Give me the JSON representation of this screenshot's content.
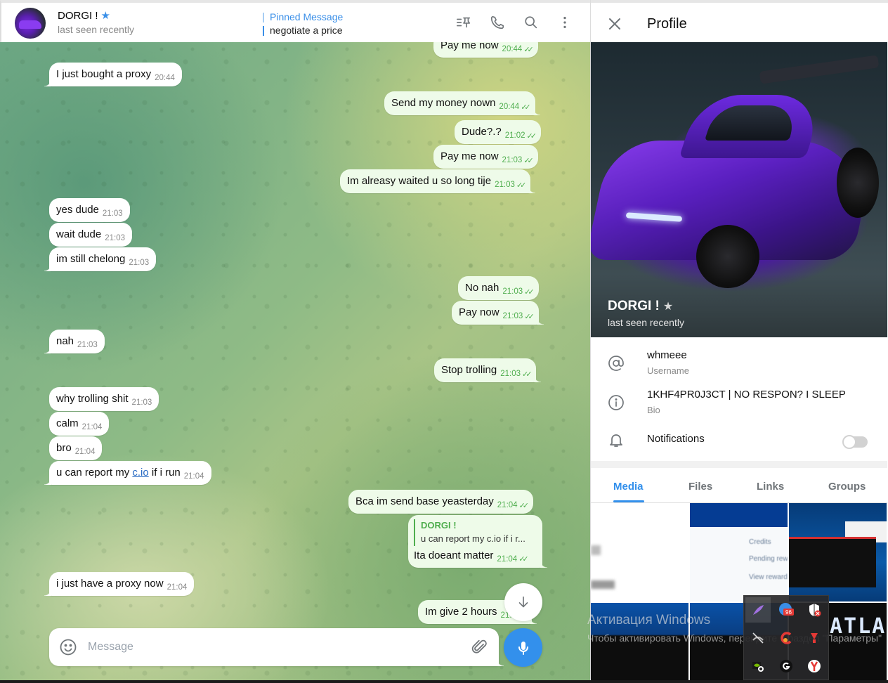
{
  "chat": {
    "peer": {
      "name": "DORGI !",
      "status": "last seen recently",
      "star_color": "#3a8fe8"
    },
    "pinned": {
      "title": "Pinned Message",
      "text": "negotiate a price"
    },
    "header_icons": [
      "pinned-list-icon",
      "phone-icon",
      "search-icon",
      "more-vertical-icon"
    ],
    "messages": [
      {
        "dir": "out",
        "text": "Pay me now",
        "time": "20:44",
        "read": true
      },
      {
        "dir": "in",
        "text": "I just bought a proxy",
        "time": "20:44"
      },
      {
        "dir": "out",
        "text": "Send my money nown",
        "time": "20:44",
        "read": true
      },
      {
        "dir": "out",
        "text": "Dude?.?",
        "time": "21:02",
        "read": true
      },
      {
        "dir": "out",
        "text": "Pay me now",
        "time": "21:03",
        "read": true
      },
      {
        "dir": "out",
        "text": "Im alreasy waited u so long tije",
        "time": "21:03",
        "read": true
      },
      {
        "dir": "in",
        "text": "yes dude",
        "time": "21:03"
      },
      {
        "dir": "in",
        "text": "wait dude",
        "time": "21:03"
      },
      {
        "dir": "in",
        "text": "im still chelong",
        "time": "21:03"
      },
      {
        "dir": "out",
        "text": "No nah",
        "time": "21:03",
        "read": true
      },
      {
        "dir": "out",
        "text": "Pay now",
        "time": "21:03",
        "read": true
      },
      {
        "dir": "in",
        "text": "nah",
        "time": "21:03"
      },
      {
        "dir": "out",
        "text": "Stop trolling",
        "time": "21:03",
        "read": true
      },
      {
        "dir": "in",
        "text": "why trolling shit",
        "time": "21:03"
      },
      {
        "dir": "in",
        "text": "calm",
        "time": "21:04"
      },
      {
        "dir": "in",
        "text": "bro",
        "time": "21:04"
      },
      {
        "dir": "in",
        "text_before": "u can report my ",
        "link": "c.io",
        "text_after": " if i run",
        "time": "21:04"
      },
      {
        "dir": "out",
        "text": "Bca im send base yeasterday",
        "time": "21:04",
        "read": true
      },
      {
        "dir": "out",
        "reply_to_author": "DORGI !",
        "reply_to_text": "u can report my c.io if i r...",
        "text": "Ita doeant matter",
        "time": "21:04",
        "read": true
      },
      {
        "dir": "in",
        "text": "i just have a proxy now",
        "time": "21:04"
      },
      {
        "dir": "out",
        "text": "Im give 2 hours",
        "time": "21:..",
        "read": true
      }
    ],
    "read_ticks": "✓✓",
    "composer": {
      "placeholder": "Message",
      "value": ""
    },
    "colors": {
      "accent": "#3390ec",
      "out_bubble": "#eefbe9",
      "out_meta": "#4fae4e",
      "in_bubble": "#ffffff"
    }
  },
  "profile": {
    "title": "Profile",
    "name": "DORGI !",
    "status": "last seen recently",
    "username": "whmeee",
    "username_label": "Username",
    "bio": "1KHF4PR0J3CT | NO RESPON? I SLEEP",
    "bio_label": "Bio",
    "notifications_label": "Notifications",
    "notifications_enabled": false,
    "tabs": [
      {
        "label": "Media",
        "active": true
      },
      {
        "label": "Files",
        "active": false
      },
      {
        "label": "Links",
        "active": false
      },
      {
        "label": "Groups",
        "active": false
      }
    ],
    "media_thumb_texts": {
      "credits": "Credits",
      "pending": "Pending rewa",
      "view": "View rewards",
      "atlas": "ATLAN"
    }
  },
  "os_overlay": {
    "activation_title": "Активация Windows",
    "activation_text": "Чтобы активировать Windows, перейдите в раздел \"Параметры\"",
    "tray_icons": [
      "feather-icon",
      "badge-96-icon",
      "shield-alert-icon",
      "network-off-icon",
      "ccleaner-icon",
      "download-arrow-icon",
      "nvidia-icon",
      "logitech-g-icon",
      "yandex-browser-icon"
    ],
    "tray_badge": "96"
  }
}
